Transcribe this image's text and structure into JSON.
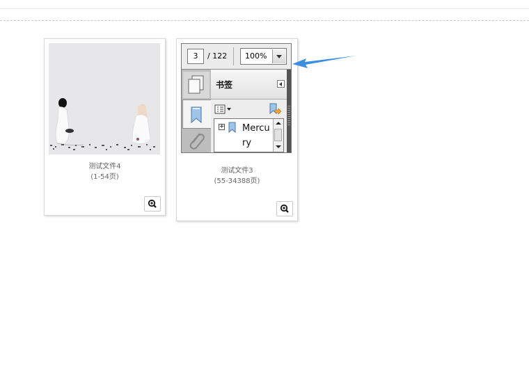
{
  "cards": [
    {
      "caption": "测试文件4",
      "pages": "(1-54页)",
      "zoom_icon": "zoom-in-icon"
    },
    {
      "caption": "测试文件3",
      "pages": "(55-34388页)",
      "zoom_icon": "zoom-in-icon",
      "pdf_viewer": {
        "page_current": "3",
        "page_total": "/ 122",
        "zoom": "100%",
        "panel_title": "书签",
        "bookmark_item": "Mercury",
        "icons": [
          "pages-icon",
          "bookmark-icon",
          "attachment-icon",
          "options-icon",
          "bookmark-action-icon",
          "expand-icon",
          "collapse-panel-icon"
        ]
      }
    }
  ],
  "colors": {
    "arrow": "#3b8ee0",
    "thumb_bg": "#e7e6e8"
  }
}
